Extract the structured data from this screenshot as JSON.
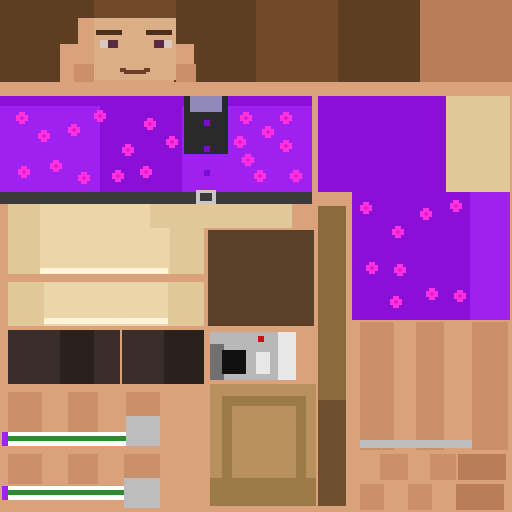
{
  "texture": {
    "kind": "player-skin-texture",
    "palette": {
      "skin": "#d9a27a",
      "skin_light": "#dcae86",
      "skin_shadow": "#c9906a",
      "skin_dark": "#b97e59",
      "hair": "#5e3e20",
      "hair_light": "#7a5230",
      "hair_mid": "#704a2a",
      "eye_white": "#d8c8bf",
      "eye_pupil": "#5a2a40",
      "brow": "#4c2f1a",
      "mouth": "#6b3d2a",
      "shirt_purple": "#a020f0",
      "shirt_purple_dark": "#8a10d8",
      "shirt_purple_deep": "#7a0ccc",
      "flower_pink": "#ff30e0",
      "flower_center": "#e010c8",
      "collar_grey": "#9088b8",
      "tie_black": "#2a2a2a",
      "belt": "#3a3a3a",
      "buckle": "#c8c8c8",
      "pants_cream": "#e0c89a",
      "pants_cream_light": "#ead6a8",
      "pants_stripe": "#fff4d8",
      "shoe_dark": "#3a2e2a",
      "shoe_darker": "#2a201c",
      "sock_white": "#ffffff",
      "sock_green": "#2e8a2e",
      "sock_purple": "#a020f0",
      "sock_grey": "#bdbdbd",
      "camera_grey": "#b8b8b8",
      "camera_dark": "#707070",
      "camera_lens": "#111111",
      "camera_light": "#e8e8e8",
      "camera_red": "#d01010",
      "bag_tan": "#b8905e",
      "bag_dark": "#9c7a48",
      "strap_brown": "#8c6a40",
      "strap_dark": "#6e5030",
      "wood_brown": "#5a4026"
    }
  }
}
